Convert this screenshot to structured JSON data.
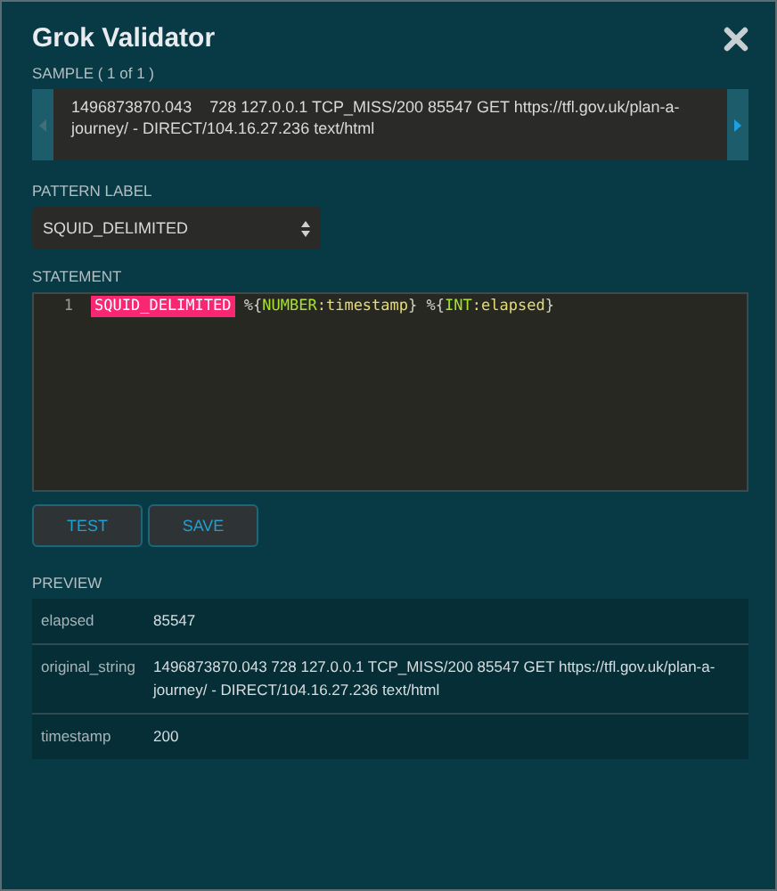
{
  "window": {
    "title": "Grok Validator"
  },
  "sample": {
    "label": "SAMPLE ( 1 of 1 )",
    "text": "1496873870.043    728 127.0.0.1 TCP_MISS/200 85547 GET https://tfl.gov.uk/plan-a-journey/ - DIRECT/104.16.27.236 text/html",
    "prev_disabled": true,
    "next_disabled": false
  },
  "pattern_label": {
    "label": "PATTERN LABEL",
    "value": "SQUID_DELIMITED"
  },
  "statement": {
    "label": "STATEMENT",
    "lines": [
      {
        "number": "1",
        "tokens": [
          {
            "kind": "label",
            "text": "SQUID_DELIMITED"
          },
          {
            "kind": "punct",
            "text": " %{"
          },
          {
            "kind": "type",
            "text": "NUMBER"
          },
          {
            "kind": "field",
            "text": ":timestamp"
          },
          {
            "kind": "punct",
            "text": "} %{"
          },
          {
            "kind": "type",
            "text": "INT"
          },
          {
            "kind": "field",
            "text": ":elapsed"
          },
          {
            "kind": "punct",
            "text": "}"
          }
        ]
      }
    ]
  },
  "buttons": [
    "TEST",
    "SAVE"
  ],
  "preview": {
    "label": "PREVIEW",
    "rows": [
      {
        "key": "elapsed",
        "value": "85547"
      },
      {
        "key": "original_string",
        "value": "1496873870.043 728 127.0.0.1 TCP_MISS/200 85547 GET https://tfl.gov.uk/plan-a-journey/ - DIRECT/104.16.27.236 text/html"
      },
      {
        "key": "timestamp",
        "value": "200"
      }
    ]
  }
}
